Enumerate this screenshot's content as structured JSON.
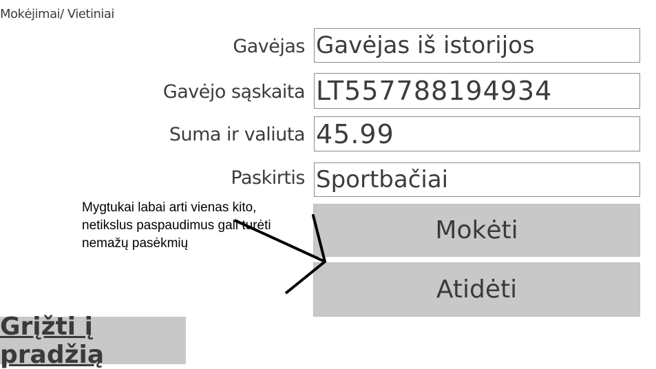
{
  "breadcrumb": "Mokėjimai/ Vietiniai",
  "form": {
    "recipient_label": "Gavėjas",
    "recipient_value": "Gavėjas iš istorijos",
    "account_label": "Gavėjo sąskaita",
    "account_value": "LT557788194934",
    "amount_label": "Suma ir valiuta",
    "amount_value": "45.99",
    "purpose_label": "Paskirtis",
    "purpose_value": "Sportbačiai"
  },
  "buttons": {
    "pay": "Mokėti",
    "postpone": "Atidėti",
    "home": "Grįžti į pradžią"
  },
  "annotation": {
    "text": "Mygtukai labai arti vienas kito, netikslus paspaudimus gali turėti nemažų pasėkmių"
  },
  "colors": {
    "button_bg": "#c8c8c8",
    "field_border": "#8a8a8a",
    "text": "#3c3c3c"
  }
}
